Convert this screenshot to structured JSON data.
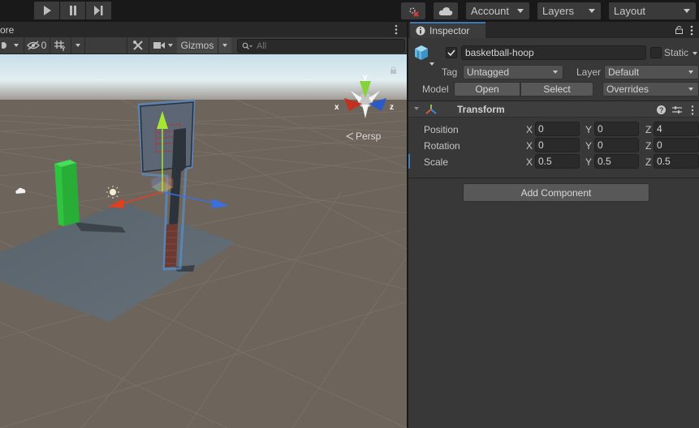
{
  "toolbar": {
    "play": {
      "icon": "play-icon"
    },
    "pause": {
      "icon": "pause-icon"
    },
    "step": {
      "icon": "step-icon"
    },
    "collab_icon": "collab-error-icon",
    "cloud_icon": "cloud-icon",
    "account_label": "Account",
    "layers_label": "Layers",
    "layout_label": "Layout"
  },
  "scene": {
    "tab_label": "ore",
    "toolbar": {
      "hidden_count": "0",
      "gizmos_label": "Gizmos",
      "search_placeholder": "All"
    },
    "gizmo": {
      "x_label": "x",
      "y_label": "y",
      "z_label": "z",
      "projection_label": "Persp"
    },
    "colors": {
      "sky": "#cfe3ec",
      "ground": "#6d645c",
      "plane": "#5b6670",
      "green_cube": "#2fc43f",
      "x_axis": "#e0401f",
      "y_axis": "#a5e632",
      "z_axis": "#3b6ee0"
    }
  },
  "inspector": {
    "tab_label": "Inspector",
    "object": {
      "active": true,
      "name": "basketball-hoop",
      "static_label": "Static",
      "static_checked": false,
      "tag_label": "Tag",
      "tag_value": "Untagged",
      "layer_label": "Layer",
      "layer_value": "Default",
      "model_label": "Model",
      "open_label": "Open",
      "select_label": "Select",
      "overrides_label": "Overrides"
    },
    "transform": {
      "title": "Transform",
      "rows": [
        {
          "label": "Position",
          "x": "0",
          "y": "0",
          "z": "4"
        },
        {
          "label": "Rotation",
          "x": "0",
          "y": "0",
          "z": "0"
        },
        {
          "label": "Scale",
          "x": "0.5",
          "y": "0.5",
          "z": "0.5"
        }
      ],
      "axis_x": "X",
      "axis_y": "Y",
      "axis_z": "Z"
    },
    "add_component_label": "Add Component"
  }
}
